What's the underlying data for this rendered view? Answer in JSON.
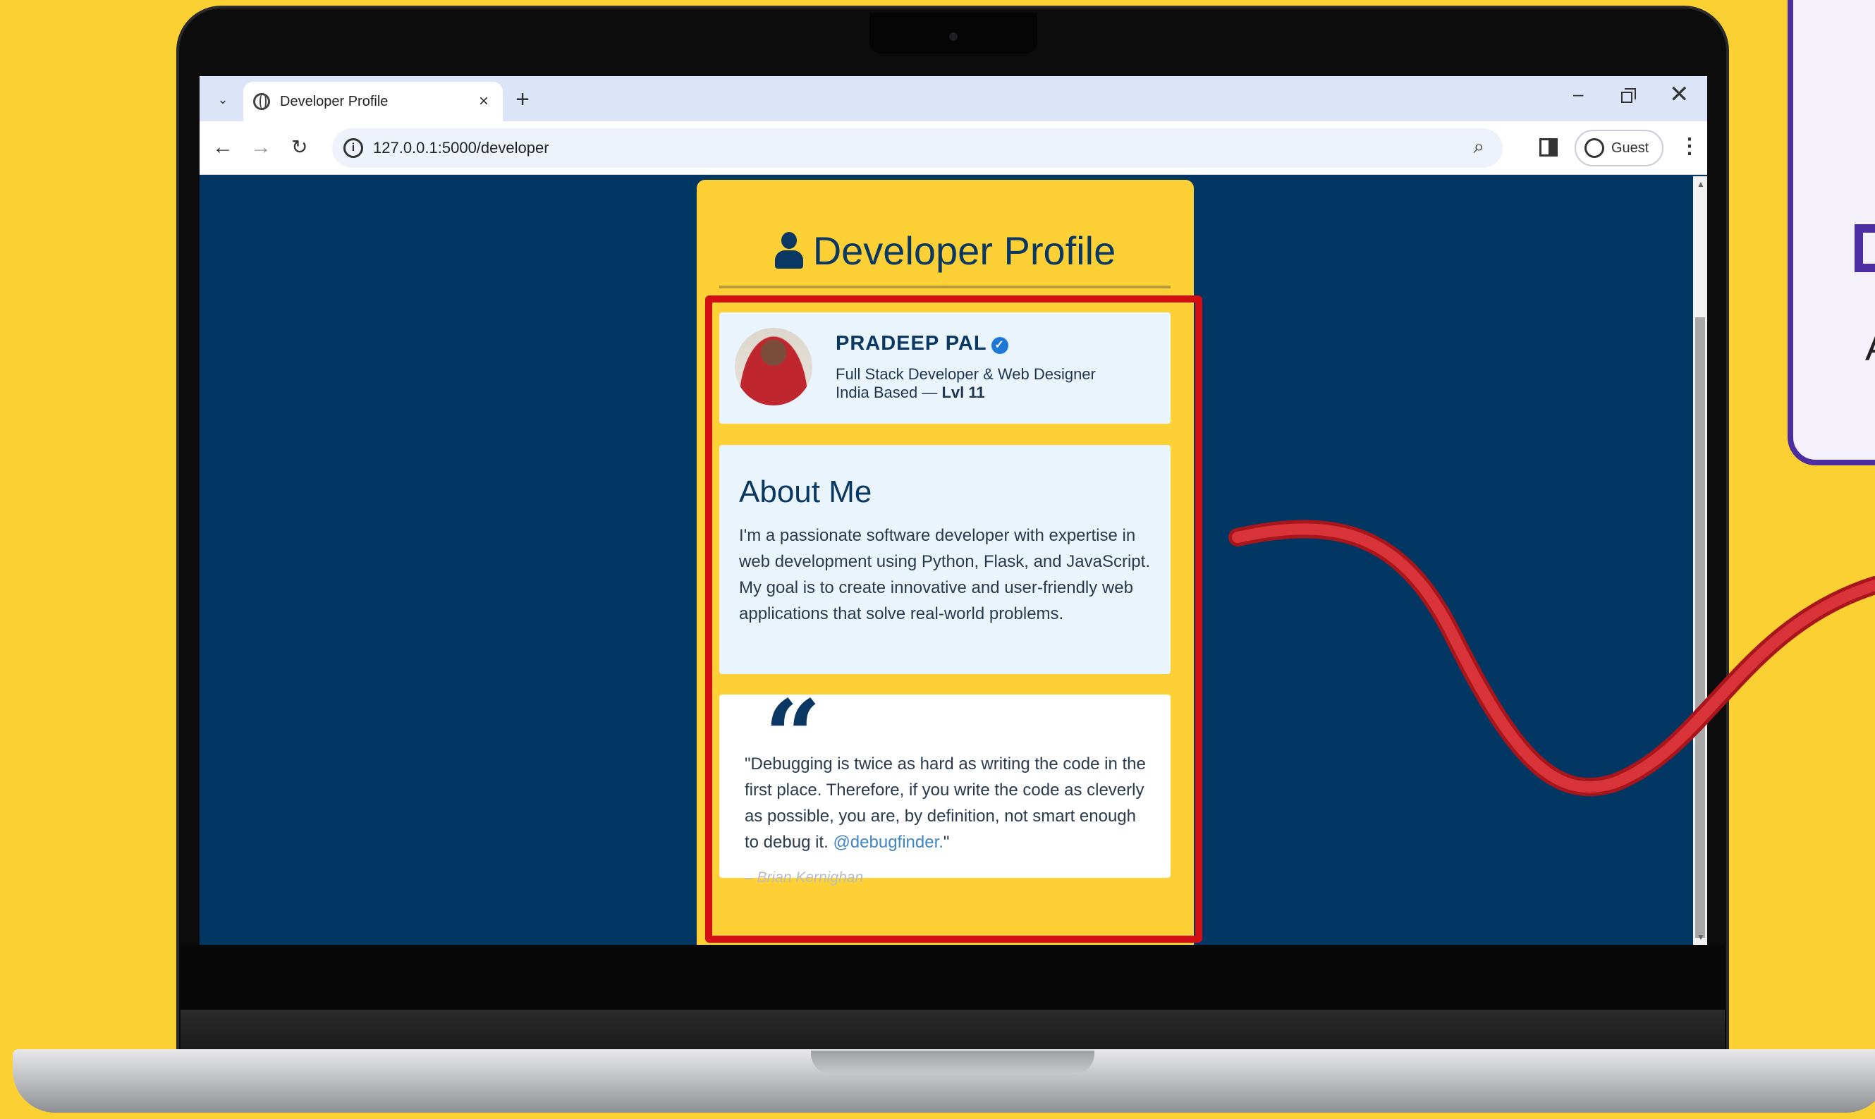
{
  "browser": {
    "tab_title": "Developer Profile",
    "tab_close_glyph": "×",
    "new_tab_glyph": "+",
    "url": "127.0.0.1:5000/developer",
    "profile_label": "Guest",
    "tab_search_glyph": "⌄",
    "back_glyph": "←",
    "forward_glyph": "→",
    "reload_glyph": "↻",
    "info_glyph": "i",
    "zoom_glyph": "⌕",
    "menu_glyph": "⋮",
    "minimize_glyph": "–",
    "close_glyph": "✕",
    "scroll_up_glyph": "▲",
    "scroll_down_glyph": "▼"
  },
  "page": {
    "title": "Developer Profile",
    "profile": {
      "name": "PRADEEP PAL",
      "verified_glyph": "✓",
      "role": "Full Stack Developer & Web Designer",
      "location": "India Based — ",
      "level": "Lvl 11"
    },
    "about": {
      "heading": "About Me",
      "text": "I'm a passionate software developer with expertise in web development using Python, Flask, and JavaScript. My goal is to create innovative and user-friendly web applications that solve real-world problems."
    },
    "quote": {
      "mark": "“",
      "text_before": "\"Debugging is twice as hard as writing the code in the first place. Therefore, if you write the code as cleverly as possible, you are, by definition, not smart enough to debug it. ",
      "link": "@debugfinder.",
      "text_after": "\"",
      "author": "– Brian Kernighan"
    }
  },
  "side_card": {
    "letter": "A"
  },
  "colors": {
    "background": "#fbd033",
    "page_bg": "#023663",
    "card_bg": "#fdd135",
    "accent_navy": "#0b3763",
    "highlight_red": "#d40f13",
    "side_card_purple": "#4c2ea0"
  },
  "icons": {
    "tab_favicon": "globe-icon",
    "title_icon": "user-icon",
    "badge_icon": "verified-check-icon",
    "swoosh": "red-curve-arrow"
  }
}
